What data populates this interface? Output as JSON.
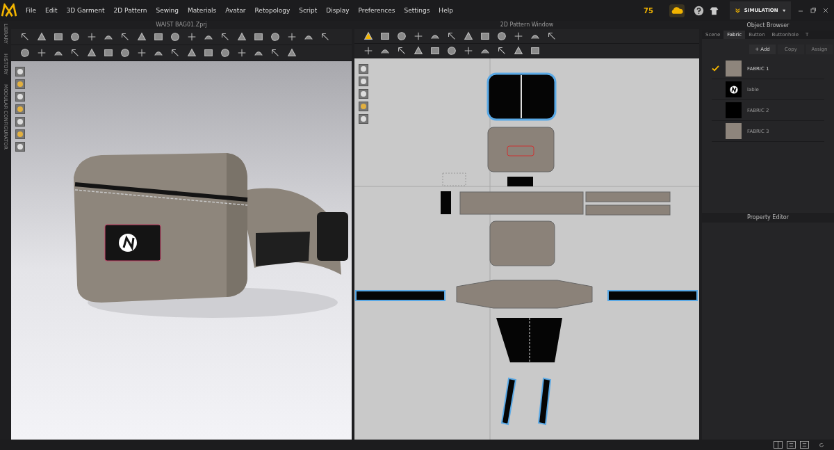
{
  "menu": [
    "File",
    "Edit",
    "3D Garment",
    "2D Pattern",
    "Sewing",
    "Materials",
    "Avatar",
    "Retopology",
    "Script",
    "Display",
    "Preferences",
    "Settings",
    "Help"
  ],
  "fps": "75",
  "mode_button": "SIMULATION",
  "side_tabs": [
    "LIBRARY",
    "HISTORY",
    "MODULAR CONFIGURATOR"
  ],
  "view3d": {
    "title": "WAIST BAG01.Zprj"
  },
  "view2d": {
    "title": "2D Pattern Window"
  },
  "object_browser": {
    "title": "Object Browser",
    "tabs": [
      {
        "label": "Scene",
        "selected": false
      },
      {
        "label": "Fabric",
        "selected": true
      },
      {
        "label": "Button",
        "selected": false
      },
      {
        "label": "Buttonhole",
        "selected": false
      },
      {
        "label": "T",
        "selected": false
      }
    ],
    "buttons": [
      {
        "label": "+ Add",
        "disabled": false
      },
      {
        "label": "Copy",
        "disabled": true
      },
      {
        "label": "Assign",
        "disabled": true
      }
    ],
    "fabrics": [
      {
        "name": "FABRIC 1",
        "selected": true,
        "color": "#8e857c",
        "kind": "plain"
      },
      {
        "name": "lable",
        "selected": false,
        "color": "#000000",
        "kind": "logo"
      },
      {
        "name": "FABRIC 2",
        "selected": false,
        "color": "#000000",
        "kind": "plain"
      },
      {
        "name": "FABRIC 3",
        "selected": false,
        "color": "#8e857c",
        "kind": "plain"
      }
    ]
  },
  "property_editor": {
    "title": "Property Editor"
  }
}
